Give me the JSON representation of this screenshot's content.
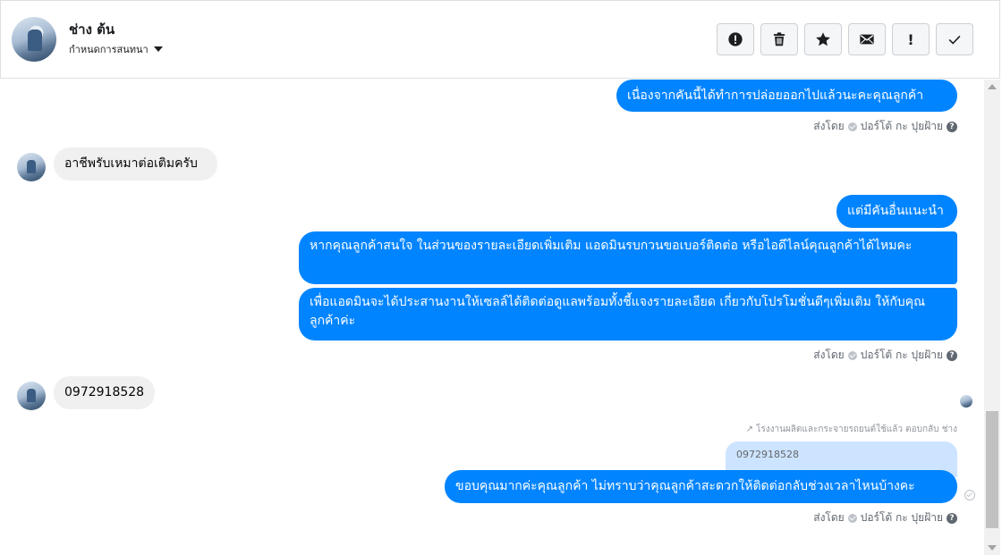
{
  "header": {
    "name": "ช่าง ต้น",
    "subtitle": "กำหนดการสนทนา",
    "toolbar": [
      {
        "icon": "alert-circle-icon"
      },
      {
        "icon": "trash-icon"
      },
      {
        "icon": "star-icon"
      },
      {
        "icon": "envelope-icon"
      },
      {
        "icon": "exclamation-icon",
        "text": "!"
      },
      {
        "icon": "check-icon"
      }
    ]
  },
  "messages": {
    "m1": "เนื่องจากคันนี้ได้ทำการปล่อยออกไปแล้วนะคะคุณลูกค้า",
    "sent_by_1": "ส่งโดย",
    "sender_1": "ปอร์โต้ กะ ปุยฝ้าย",
    "in1": "อาชีพรับเหมาต่อเติมครับ",
    "m2": "แต่มีคันอื่นแนะนำ",
    "m3": "หากคุณลูกค้าสนใจ ในส่วนของรายละเอียดเพิ่มเติม แอดมินรบกวนขอเบอร์ติดต่อ หรือไอดีไลน์คุณลูกค้าได้ไหมคะ",
    "m4": "เพื่อแอดมินจะได้ประสานงานให้เซลล์ได้ติดต่อดูแลพร้อมทั้งชี้แจงรายละเอียด เกี่ยวกับโปรโมชั่นดีๆเพิ่มเติม ให้กับคุณลูกค้าค่ะ",
    "sent_by_2": "ส่งโดย",
    "sender_2": "ปอร์โต้ กะ ปุยฝ้าย",
    "in2": "0972918528",
    "reply_label": "โรงงานผลิตและกระจายรถยนต์ใช้แล้ว ตอบกลับ ช่าง",
    "reply_quote": "0972918528",
    "m5": "ขอบคุณมากค่ะคุณลูกค้า ไม่ทราบว่าคุณลูกค้าสะดวกให้ติดต่อกลับช่วงเวลาไหนบ้างคะ",
    "sent_by_3": "ส่งโดย",
    "sender_3": "ปอร์โต้ กะ ปุยฝ้าย"
  },
  "colors": {
    "outgoing_bubble": "#0084ff",
    "incoming_bubble": "#f0f0f0",
    "reply_quote_bg": "#cce4ff"
  }
}
